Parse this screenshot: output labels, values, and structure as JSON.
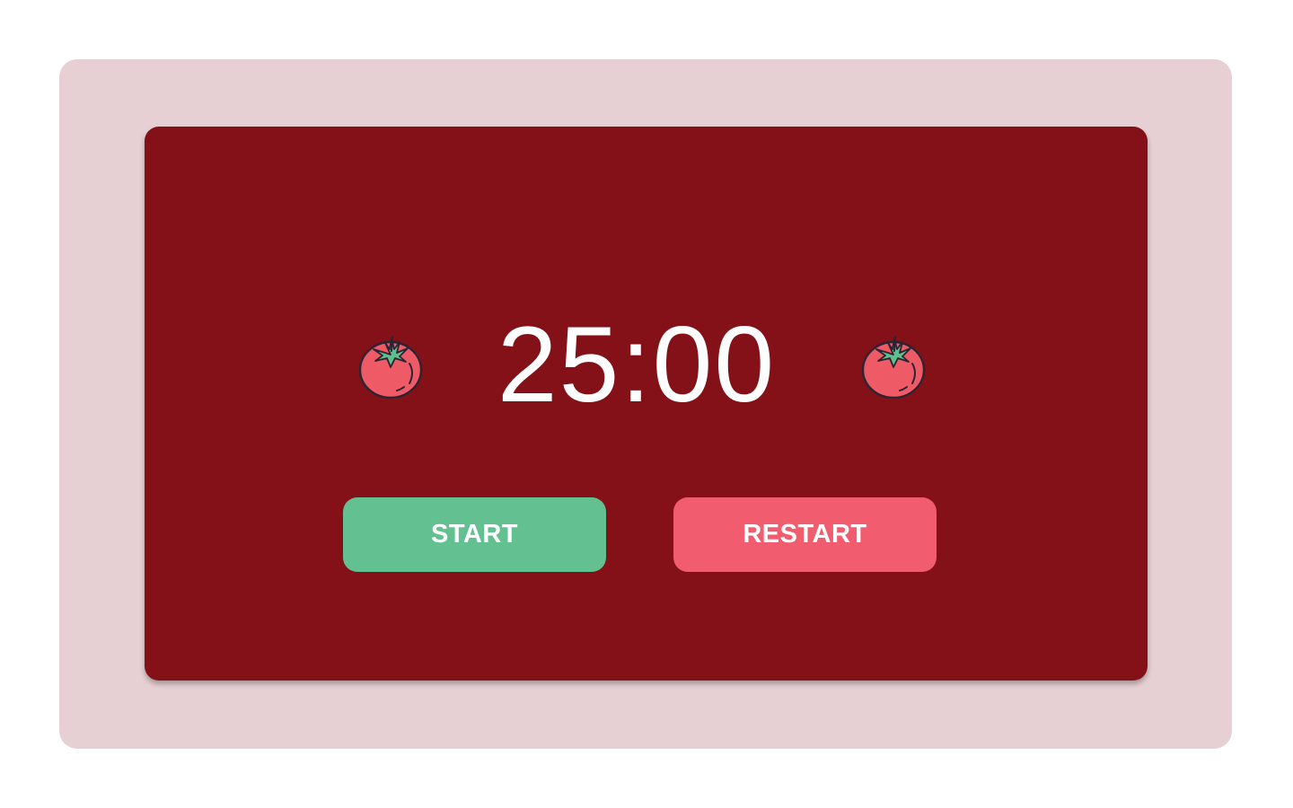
{
  "timer": {
    "display": "25:00"
  },
  "controls": {
    "start_label": "START",
    "restart_label": "RESTART"
  },
  "icons": {
    "left": "tomato-icon",
    "right": "tomato-icon"
  },
  "colors": {
    "outer_background": "#e6d0d3",
    "card_background": "#841118",
    "start_button": "#62c091",
    "restart_button": "#f15c6e",
    "timer_text": "#ffffff",
    "tomato_body": "#ef5a67",
    "tomato_leaf": "#5ec08f"
  }
}
